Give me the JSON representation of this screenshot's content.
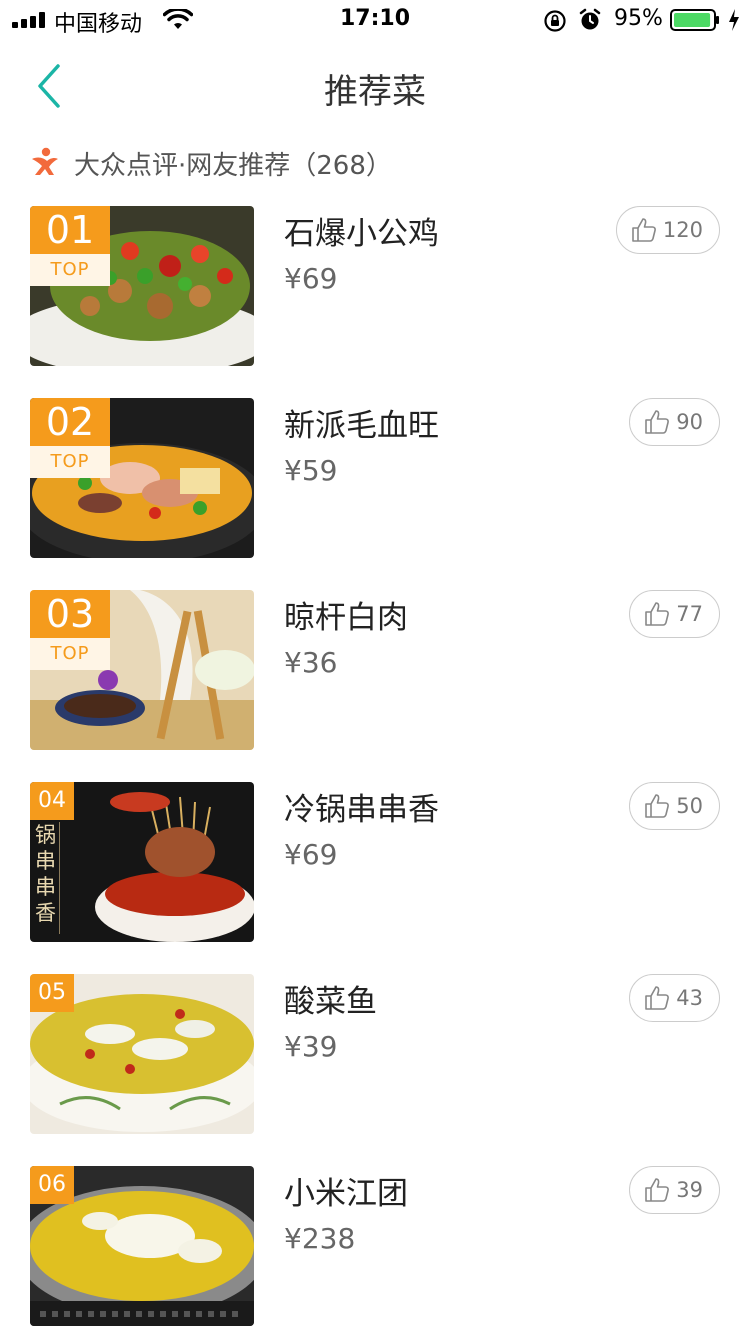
{
  "status_bar": {
    "carrier": "中国移动",
    "time": "17:10",
    "battery_percent": "95%",
    "battery_level": 0.95,
    "icons": [
      "signal-icon",
      "wifi-icon",
      "orientation-lock-icon",
      "alarm-icon",
      "battery-icon",
      "charging-icon"
    ]
  },
  "nav": {
    "title": "推荐菜",
    "back_icon": "chevron-left-icon"
  },
  "source": {
    "icon": "dianping-icon",
    "text": "大众点评·网友推荐（268）"
  },
  "colors": {
    "accent": "#f59b1c",
    "back_arrow": "#1bb5a6",
    "source_icon": "#f26a3c",
    "battery": "#4cd964"
  },
  "dishes": [
    {
      "rank": "01",
      "top_label": "TOP",
      "name": "石爆小公鸡",
      "price": "¥69",
      "likes": "120",
      "thumb_text": ""
    },
    {
      "rank": "02",
      "top_label": "TOP",
      "name": "新派毛血旺",
      "price": "¥59",
      "likes": "90",
      "thumb_text": ""
    },
    {
      "rank": "03",
      "top_label": "TOP",
      "name": "晾杆白肉",
      "price": "¥36",
      "likes": "77",
      "thumb_text": ""
    },
    {
      "rank": "04",
      "top_label": "",
      "name": "冷锅串串香",
      "price": "¥69",
      "likes": "50",
      "thumb_text": "锅串串香"
    },
    {
      "rank": "05",
      "top_label": "",
      "name": "酸菜鱼",
      "price": "¥39",
      "likes": "43",
      "thumb_text": ""
    },
    {
      "rank": "06",
      "top_label": "",
      "name": "小米江团",
      "price": "¥238",
      "likes": "39",
      "thumb_text": ""
    }
  ]
}
